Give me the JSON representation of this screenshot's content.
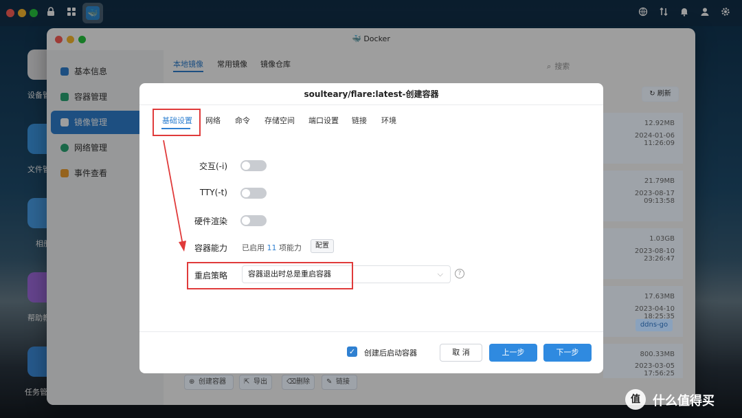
{
  "topbar": {
    "icons": [
      "lock-icon",
      "grid-icon",
      "docker-icon",
      "globe-icon",
      "transfer-icon",
      "bell-icon",
      "user-icon",
      "gear-icon"
    ]
  },
  "desktop": {
    "labels": [
      "设备管",
      "文件管",
      "相册",
      "帮助教",
      "任务管"
    ]
  },
  "window": {
    "title": "Docker",
    "sidebar": [
      {
        "label": "基本信息",
        "icon": "docker-icon"
      },
      {
        "label": "容器管理",
        "icon": "cube-icon"
      },
      {
        "label": "镜像管理",
        "icon": "image-icon"
      },
      {
        "label": "网络管理",
        "icon": "globe-icon"
      },
      {
        "label": "事件查看",
        "icon": "event-icon"
      }
    ],
    "tabs": [
      "本地镜像",
      "常用镜像",
      "镜像仓库"
    ],
    "search_placeholder": "搜索",
    "refresh_label": "刷新",
    "images": [
      {
        "size": "12.92MB",
        "date": "2024-01-06 11:26:09"
      },
      {
        "size": "21.79MB",
        "date": "2023-08-17 09:13:58"
      },
      {
        "size": "1.03GB",
        "date": "2023-08-10 23:26:47"
      },
      {
        "size": "17.63MB",
        "date": "2023-04-10 18:25:35",
        "tag": "ddns-go"
      },
      {
        "size": "800.33MB",
        "date": "2023-03-05 17:56:25"
      }
    ],
    "bottom_actions": [
      "创建容器",
      "导出",
      "删除",
      "链接"
    ]
  },
  "dialog": {
    "title": "soulteary/flare:latest-创建容器",
    "tabs": [
      "基础设置",
      "网络",
      "命令",
      "存储空间",
      "端口设置",
      "链接",
      "环境"
    ],
    "fields": {
      "interactive_label": "交互(-i)",
      "tty_label": "TTY(-t)",
      "hw_label": "硬件渲染",
      "capability_label": "容器能力",
      "capability_prefix": "已启用",
      "capability_count": "11",
      "capability_suffix": "项能力",
      "config_button": "配置",
      "restart_label": "重启策略",
      "restart_value": "容器退出时总是重启容器"
    },
    "footer": {
      "autostart_label": "创建后启动容器",
      "cancel": "取 消",
      "prev": "上一步",
      "next": "下一步"
    }
  },
  "watermark": {
    "icon_text": "值",
    "text": "什么值得买"
  },
  "colors": {
    "accent": "#2f80d1",
    "annotation": "#e03a3a"
  }
}
